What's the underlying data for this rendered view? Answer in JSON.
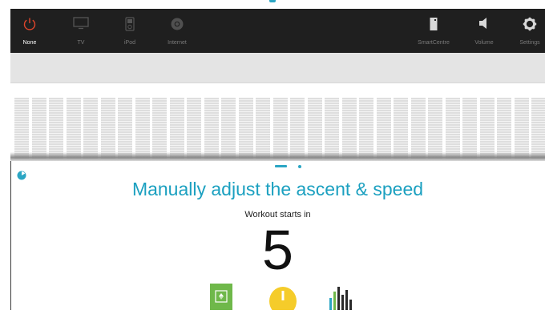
{
  "nav": {
    "left": [
      {
        "key": "none",
        "label": "None",
        "icon": "power-icon",
        "active": true
      },
      {
        "key": "tv",
        "label": "TV",
        "icon": "tv-icon",
        "active": false
      },
      {
        "key": "ipod",
        "label": "iPod",
        "icon": "ipod-icon",
        "active": false
      },
      {
        "key": "internet",
        "label": "Internet",
        "icon": "internet-icon",
        "active": false
      }
    ],
    "right": [
      {
        "key": "smartcentre",
        "label": "SmartCentre",
        "icon": "smartcentre-icon"
      },
      {
        "key": "volume",
        "label": "Volume",
        "icon": "volume-icon"
      },
      {
        "key": "settings",
        "label": "Settings",
        "icon": "gear-icon"
      }
    ]
  },
  "workout": {
    "title": "Manually adjust the ascent & speed",
    "subtitle": "Workout starts in",
    "countdown": "5"
  },
  "colors": {
    "accent": "#2ba6c4",
    "navbar": "#1f1f1f",
    "power": "#e0452b",
    "green": "#6fb84a",
    "yellow": "#f5cc2a"
  },
  "bottom_icons": [
    "manual-mode-icon",
    "timer-icon",
    "stats-icon"
  ]
}
